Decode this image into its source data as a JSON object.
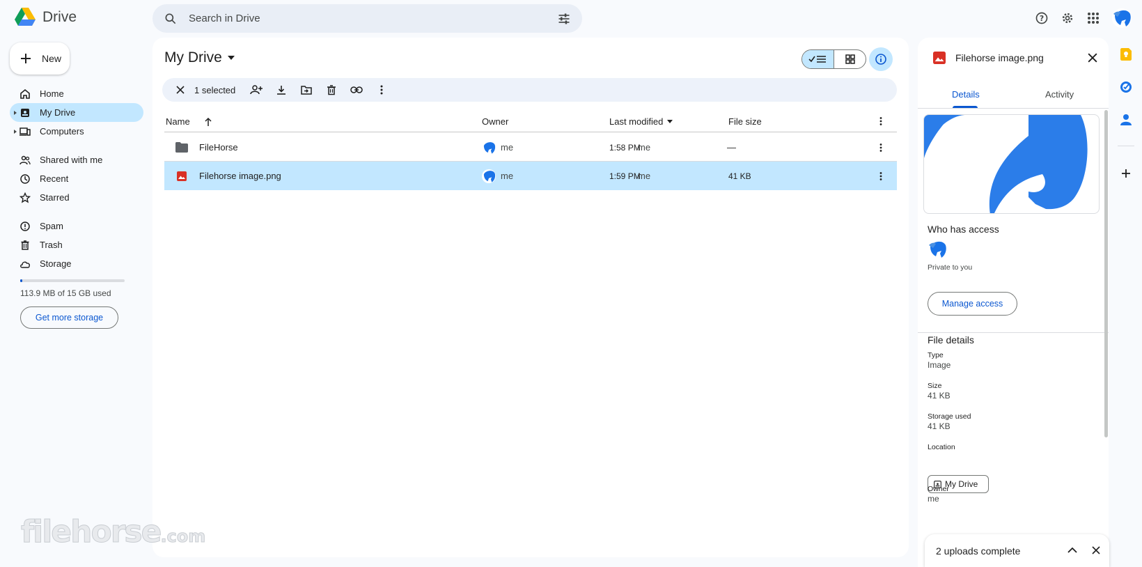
{
  "app": {
    "title": "Drive"
  },
  "search": {
    "placeholder": "Search in Drive"
  },
  "sidebar": {
    "new_label": "New",
    "items": [
      {
        "label": "Home",
        "icon": "home-icon"
      },
      {
        "label": "My Drive",
        "icon": "my-drive-icon",
        "active": true
      },
      {
        "label": "Computers",
        "icon": "computers-icon"
      },
      {
        "label": "Shared with me",
        "icon": "shared-icon"
      },
      {
        "label": "Recent",
        "icon": "clock-icon"
      },
      {
        "label": "Starred",
        "icon": "star-icon"
      },
      {
        "label": "Spam",
        "icon": "spam-icon"
      },
      {
        "label": "Trash",
        "icon": "trash-icon"
      },
      {
        "label": "Storage",
        "icon": "cloud-icon"
      }
    ],
    "storage_used_fraction": 0.0074,
    "storage_text": "113.9 MB of 15 GB used",
    "get_storage_label": "Get more storage"
  },
  "main": {
    "title": "My Drive",
    "selection": {
      "count_label": "1 selected"
    },
    "columns": {
      "name": "Name",
      "owner": "Owner",
      "modified": "Last modified",
      "size": "File size"
    },
    "rows": [
      {
        "name": "FileHorse",
        "type": "folder",
        "owner": "me",
        "modified": "1:58 PM",
        "modified_by": "me",
        "size": "—",
        "selected": false
      },
      {
        "name": "Filehorse image.png",
        "type": "image",
        "owner": "me",
        "modified": "1:59 PM",
        "modified_by": "me",
        "size": "41 KB",
        "selected": true
      }
    ]
  },
  "details": {
    "file_name": "Filehorse image.png",
    "tabs": {
      "details": "Details",
      "activity": "Activity"
    },
    "who_has_access": "Who has access",
    "private_text": "Private to you",
    "manage_access": "Manage access",
    "file_details": "File details",
    "type_label": "Type",
    "type_value": "Image",
    "size_label": "Size",
    "size_value": "41 KB",
    "storage_label": "Storage used",
    "storage_value": "41 KB",
    "location_label": "Location",
    "location_value": "My Drive",
    "owner_label": "Owner",
    "owner_value": "me"
  },
  "uploads": {
    "label": "2 uploads complete"
  },
  "watermark": {
    "text": "filehorse",
    "suffix": ".com"
  },
  "colors": {
    "accent": "#0b57d0",
    "selected": "#c2e7ff",
    "background": "#f8fafd"
  }
}
